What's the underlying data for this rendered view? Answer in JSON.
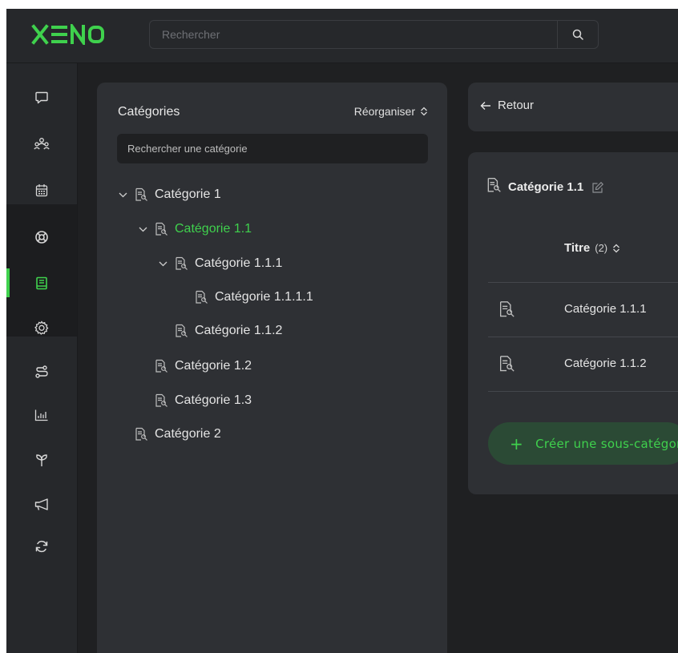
{
  "app": {
    "logo": "XENO"
  },
  "search": {
    "placeholder": "Rechercher"
  },
  "sidebar": {
    "items": [
      {
        "icon": "chat-icon"
      },
      {
        "icon": "users-icon"
      },
      {
        "icon": "calendar-icon"
      },
      {
        "icon": "lifebuoy-icon"
      },
      {
        "icon": "book-icon",
        "active": true
      },
      {
        "icon": "gear-icon"
      },
      {
        "icon": "route-icon"
      },
      {
        "icon": "bar-chart-icon"
      },
      {
        "icon": "sprout-icon"
      },
      {
        "icon": "megaphone-icon"
      },
      {
        "icon": "sync-icon"
      }
    ]
  },
  "categories": {
    "title": "Catégories",
    "reorganize_label": "Réorganiser",
    "search_placeholder": "Rechercher une catégorie",
    "tree": [
      {
        "label": "Catégorie 1",
        "level": 0,
        "expanded": true
      },
      {
        "label": "Catégorie 1.1",
        "level": 1,
        "expanded": true,
        "selected": true
      },
      {
        "label": "Catégorie 1.1.1",
        "level": 2,
        "expanded": true
      },
      {
        "label": "Catégorie 1.1.1.1",
        "level": 3
      },
      {
        "label": "Catégorie 1.1.2",
        "level": 2
      },
      {
        "label": "Catégorie 1.2",
        "level": 1
      },
      {
        "label": "Catégorie 1.3",
        "level": 1
      },
      {
        "label": "Catégorie 2",
        "level": 0
      }
    ]
  },
  "detail": {
    "back_label": "Retour",
    "title": "Catégorie 1.1",
    "column_title": "Titre",
    "column_count": "(2)",
    "rows": [
      "Catégorie 1.1.1",
      "Catégorie 1.1.2"
    ],
    "create_label": "Créer une sous-catégorie"
  },
  "colors": {
    "accent": "#3fd14d",
    "panel": "#2e3034",
    "background": "#1f2022"
  }
}
